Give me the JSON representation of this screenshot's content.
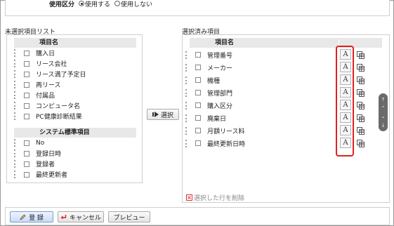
{
  "usage": {
    "label": "使用区分",
    "options": [
      {
        "label": "使用する",
        "selected": true
      },
      {
        "label": "使用しない",
        "selected": false
      }
    ]
  },
  "left": {
    "title": "未選択項目リスト",
    "header1": "項目名",
    "items1": [
      "購入日",
      "リース会社",
      "リース満了予定日",
      "再リース",
      "付属品",
      "コンピュータ名",
      "PC健康診断結果"
    ],
    "header2": "システム標準項目",
    "items2": [
      "No",
      "登録日時",
      "登録者",
      "最終更新者"
    ]
  },
  "select_button": "選択",
  "right": {
    "title": "選択済み項目",
    "header": "項目名",
    "items": [
      "管理番号",
      "メーカー",
      "機種",
      "管理部門",
      "購入区分",
      "廃棄日",
      "月額リース料",
      "最終更新日時"
    ],
    "format_button": "A",
    "delete_label": "選択した行を削除"
  },
  "footer": {
    "register": "登 録",
    "cancel": "キャンセル",
    "preview": "プレビュー"
  },
  "colors": {
    "highlight": "#e0201e",
    "header_bg": "#e8e8e8"
  }
}
